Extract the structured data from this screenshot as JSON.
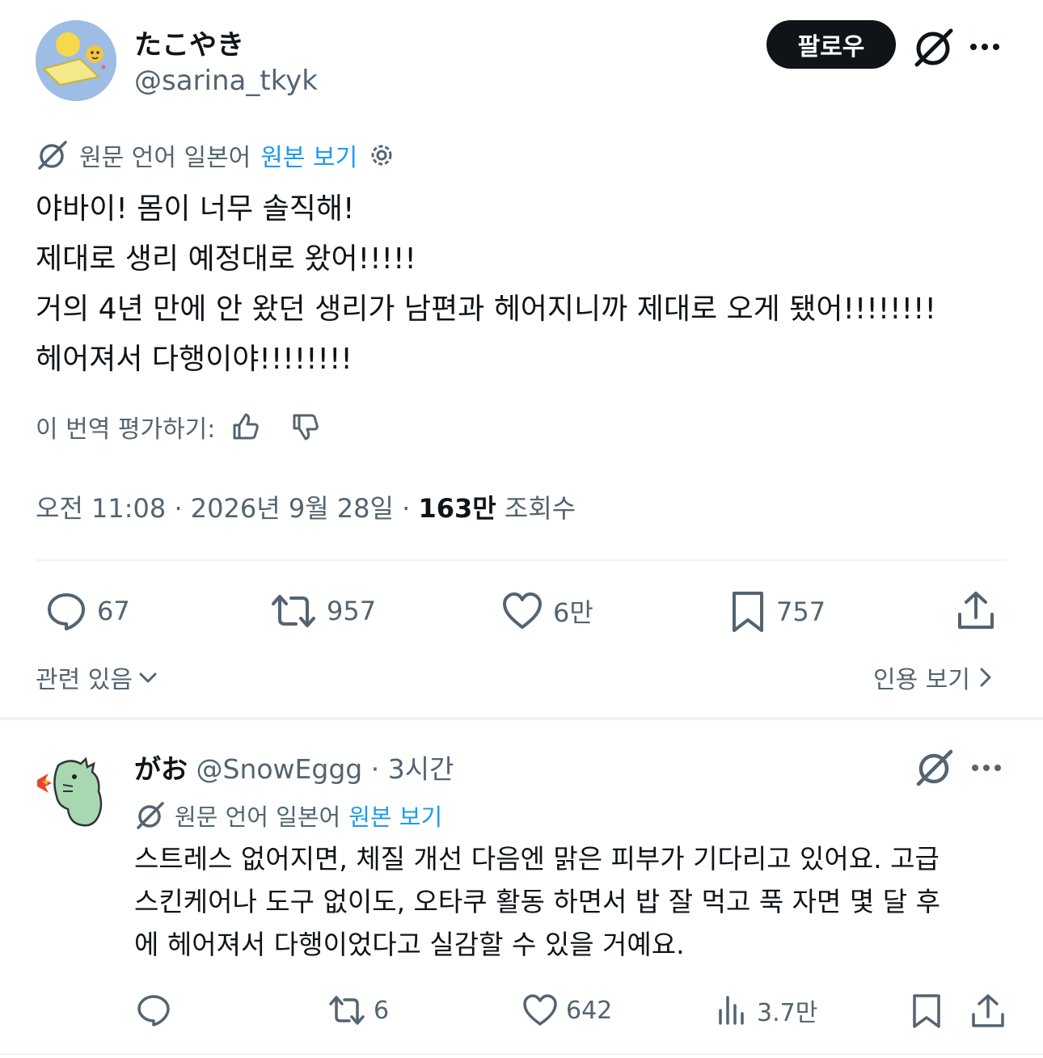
{
  "main_tweet": {
    "display_name": "たこやき",
    "handle": "@sarina_tkyk",
    "follow_label": "팔로우",
    "translation": {
      "source_label": "원문 언어 일본어",
      "view_original": "원본 보기"
    },
    "text_lines": [
      "야바이! 몸이 너무 솔직해!",
      "제대로 생리 예정대로 왔어!!!!!",
      "거의 4년 만에 안 왔던 생리가 남편과 헤어지니까 제대로 오게 됐어!!!!!!!!",
      "헤어져서 다행이야!!!!!!!!"
    ],
    "rate_label": "이 번역 평가하기:",
    "meta": {
      "time_date": "오전 11:08 · 2026년 9월 28일 · ",
      "views_count": "163만",
      "views_label": " 조회수"
    },
    "actions": {
      "replies": "67",
      "retweets": "957",
      "likes": "6만",
      "bookmarks": "757"
    },
    "related_label": "관련 있음",
    "quotes_label": "인용 보기"
  },
  "reply": {
    "display_name": "がお",
    "handle": "@SnowEggg",
    "separator": " · ",
    "time": "3시간",
    "translation": {
      "source_label": "원문 언어 일본어",
      "view_original": "원본 보기"
    },
    "text_lines": [
      "스트레스 없어지면, 체질 개선 다음엔 맑은 피부가 기다리고 있어요. 고급",
      "스킨케어나 도구 없이도, 오타쿠 활동 하면서 밥 잘 먹고 푹 자면 몇 달 후",
      "에 헤어져서 다행이었다고 실감할 수 있을 거예요."
    ],
    "actions": {
      "retweets": "6",
      "likes": "642",
      "views": "3.7만"
    }
  },
  "colors": {
    "text_primary": "#0f1419",
    "text_secondary": "#536471",
    "link_blue": "#1d9bf0",
    "divider": "#eff3f4"
  },
  "icons": [
    "grok-icon",
    "more-icon",
    "settings-gear-icon",
    "thumbs-up-icon",
    "thumbs-down-icon",
    "reply-icon",
    "retweet-icon",
    "like-icon",
    "bookmark-icon",
    "share-icon",
    "views-icon",
    "chevron-down-icon",
    "chevron-right-icon"
  ]
}
